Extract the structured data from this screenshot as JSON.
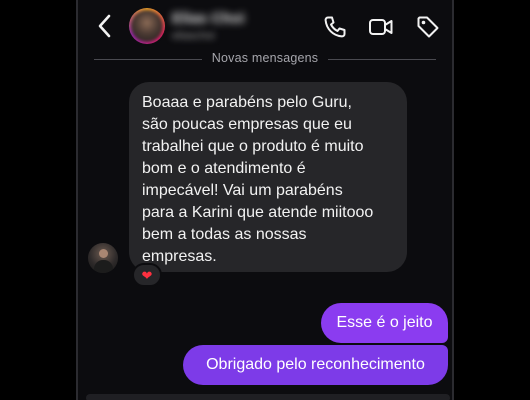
{
  "header": {
    "contact_name": "Elias Choi",
    "contact_subtitle": "eliaschoi",
    "icons": [
      "back-arrow-icon",
      "phone-icon",
      "video-call-icon",
      "tag-icon"
    ]
  },
  "divider": {
    "label": "Novas mensagens"
  },
  "messages": [
    {
      "direction": "incoming",
      "text": "Boaaa e parabéns pelo Guru,\nsão poucas empresas que eu\ntrabalhei que o produto é muito\nbom e o atendimento é\nimpecável! Vai um parabéns\npara a Karini que atende miitooo\nbem a todas as nossas\nempresas.",
      "reaction": "❤"
    },
    {
      "direction": "outgoing",
      "text": "Esse é o jeito"
    },
    {
      "direction": "outgoing",
      "text": "Obrigado pelo reconhecimento"
    }
  ],
  "colors": {
    "background": "#000000",
    "panel": "#0c0c0f",
    "incoming_bubble": "#262629",
    "outgoing_bubble": "#7d3be8",
    "reaction_heart": "#ff3040"
  }
}
